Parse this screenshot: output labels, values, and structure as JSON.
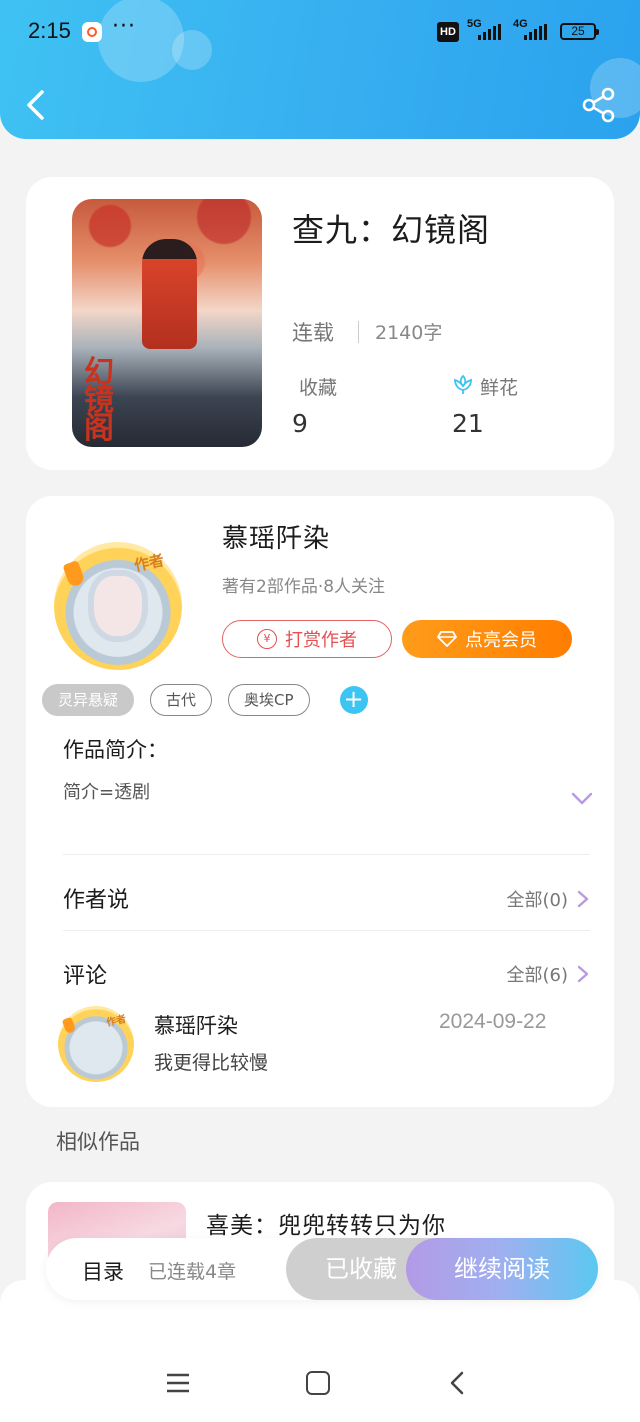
{
  "status_bar": {
    "time": "2:15",
    "more": "···",
    "hd": "HD",
    "net1": "5G",
    "net2": "4G",
    "battery": "25"
  },
  "book": {
    "title": "查九：幻镜阁",
    "status": "连载",
    "words": "2140字",
    "favorites_label": "收藏",
    "favorites_count": "9",
    "flowers_label": "鲜花",
    "flowers_count": "21",
    "cover_text": "幻镜阁"
  },
  "author": {
    "name": "慕瑶阡染",
    "meta": "著有2部作品·8人关注",
    "tip_label": "打赏作者",
    "vip_label": "点亮会员",
    "badge": "作者"
  },
  "tags": [
    "灵异悬疑",
    "古代",
    "奥埃CP"
  ],
  "intro": {
    "title": "作品简介：",
    "text": "简介=透剧"
  },
  "author_says": {
    "title": "作者说",
    "link": "全部(0)"
  },
  "comments": {
    "title": "评论",
    "link": "全部(6)",
    "items": [
      {
        "user": "慕瑶阡染",
        "date": "2024-09-22",
        "text": "我更得比较慢",
        "badge": "作者"
      }
    ]
  },
  "similar": {
    "title": "相似作品",
    "items": [
      {
        "name": "喜美：兜兜转转只为你"
      }
    ]
  },
  "bottom_bar": {
    "toc_label": "目录",
    "toc_count": "已连载4章",
    "fav_label": "已收藏",
    "read_label": "继续阅读"
  },
  "colors": {
    "header": "#37aef0",
    "accent_orange": "#ff8a00",
    "accent_red": "#e45050",
    "tag_blue": "#3cc4f2"
  }
}
